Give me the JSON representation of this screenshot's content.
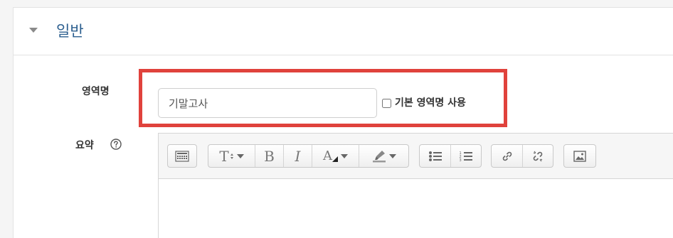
{
  "section": {
    "title": "일반",
    "collapse_icon": "caret-down-icon"
  },
  "form": {
    "name_label": "영역명",
    "name_value": "기말고사",
    "use_default_label": "기본 영역명 사용",
    "use_default_checked": false,
    "summary_label": "요약",
    "help_icon": "question-circle-icon"
  },
  "editor": {
    "toolbar": [
      "toolbar-toggle-icon",
      "font-style-icon",
      "bold-icon",
      "italic-icon",
      "font-color-icon",
      "background-color-icon",
      "unordered-list-icon",
      "ordered-list-icon",
      "link-icon",
      "unlink-icon",
      "image-icon"
    ],
    "glyphs": {
      "font_style": "T",
      "bold": "B",
      "italic": "I",
      "font_color": "A"
    }
  },
  "colors": {
    "section_title": "#2c5f8f",
    "highlight_border": "#e0423c"
  }
}
